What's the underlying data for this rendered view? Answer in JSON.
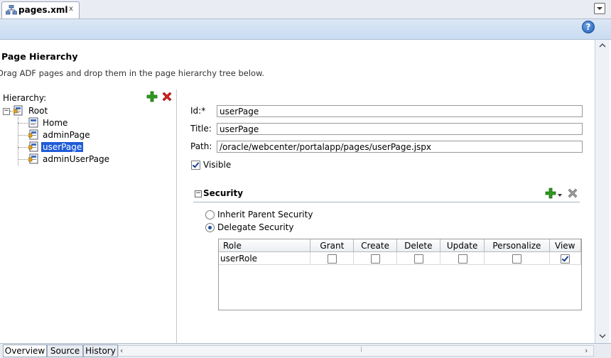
{
  "editor_tab": {
    "title": "pages.xml",
    "close_glyph": "x",
    "icon": "xml-file-icon"
  },
  "header": {
    "help_label": "?"
  },
  "page": {
    "title": "Page Hierarchy",
    "description": "Drag ADF pages and drop them in the page hierarchy tree below."
  },
  "hierarchy": {
    "label": "Hierarchy:",
    "add_icon": "add-icon",
    "delete_icon": "delete-icon",
    "tree": [
      {
        "label": "Root",
        "icon": "page-folder-icon",
        "expanded": true
      },
      {
        "label": "Home",
        "icon": "page-icon"
      },
      {
        "label": "adminPage",
        "icon": "secured-page-icon"
      },
      {
        "label": "userPage",
        "icon": "secured-page-icon",
        "selected": true
      },
      {
        "label": "adminUserPage",
        "icon": "secured-page-icon"
      }
    ]
  },
  "form": {
    "id_label": "Id:*",
    "id_value": "userPage",
    "title_label": "Title:",
    "title_value": "userPage",
    "path_label": "Path:",
    "path_value": "/oracle/webcenter/portalapp/pages/userPage.jspx",
    "visible_label": "Visible",
    "visible_checked": true
  },
  "security": {
    "title": "Security",
    "collapse_glyph": "−",
    "options": [
      {
        "label": "Inherit Parent Security",
        "selected": false
      },
      {
        "label": "Delegate Security",
        "selected": true
      }
    ],
    "table": {
      "columns": [
        "Role",
        "Grant",
        "Create",
        "Delete",
        "Update",
        "Personalize",
        "View"
      ],
      "rows": [
        {
          "role": "userRole",
          "grant": false,
          "create": false,
          "delete": false,
          "update": false,
          "personalize": false,
          "view": true
        }
      ]
    }
  },
  "bottom_tabs": [
    {
      "label": "Overview",
      "active": true
    },
    {
      "label": "Source",
      "active": false
    },
    {
      "label": "History",
      "active": false
    }
  ],
  "colors": {
    "selection": "#1e5bd7",
    "add_green": "#2e9a1e",
    "delete_red": "#d62020",
    "header_blue": "#c9dcf1"
  }
}
